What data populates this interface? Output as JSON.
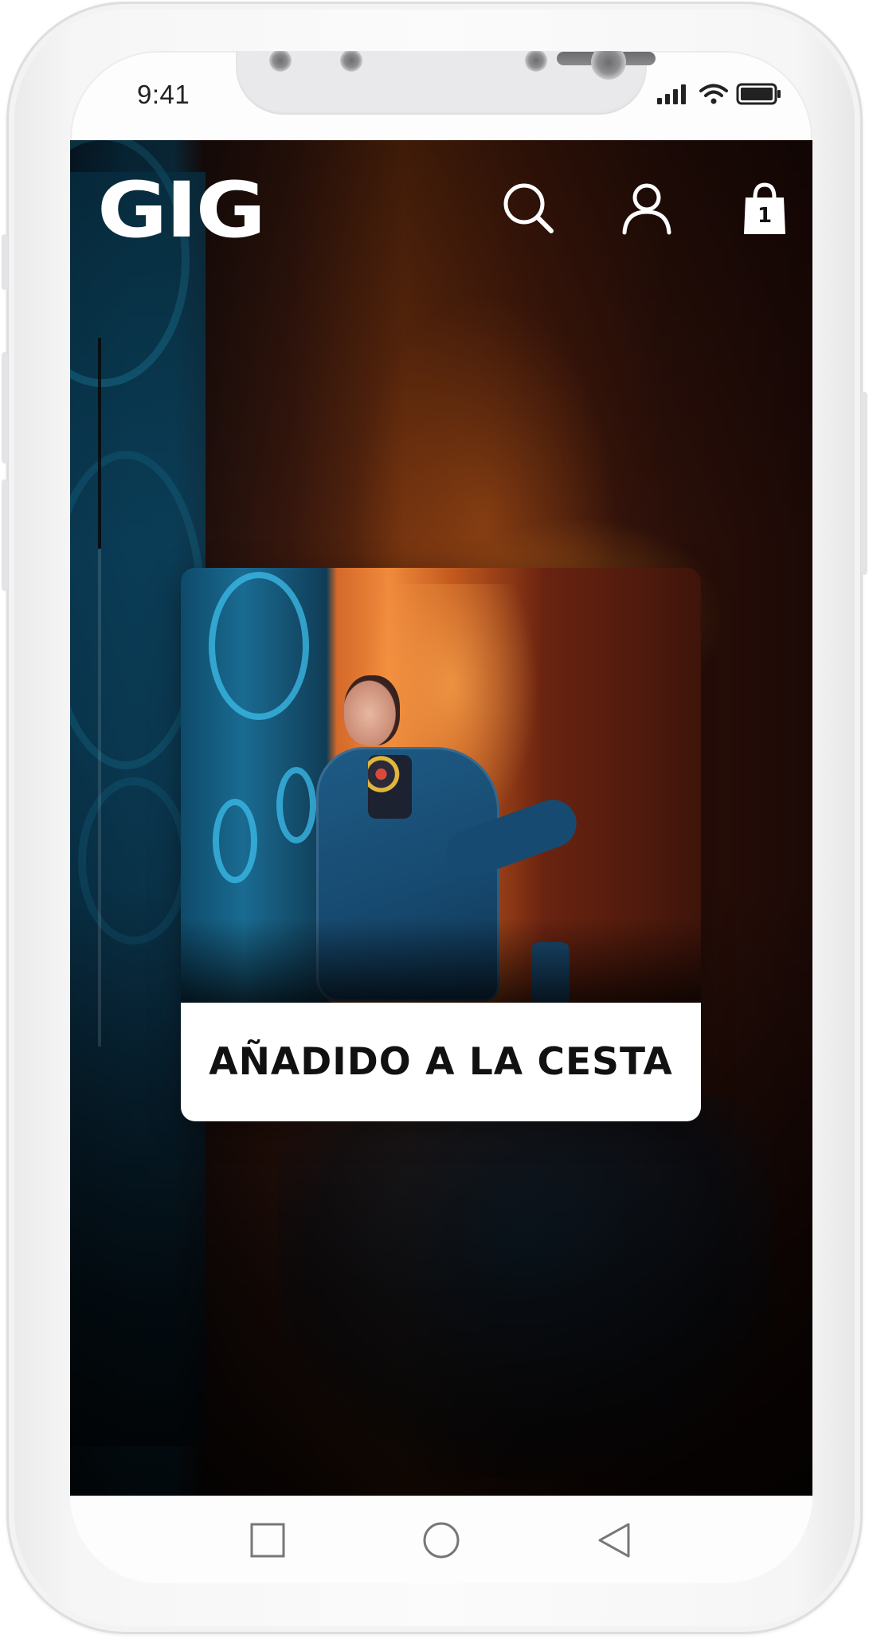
{
  "status_bar": {
    "time": "9:41"
  },
  "header": {
    "logo_text": "GIG",
    "icons": [
      "search-icon",
      "user-icon",
      "shopping-bag-icon"
    ],
    "cart_count": "1"
  },
  "modal": {
    "message": "AÑADIDO A LA CESTA"
  },
  "navigation": {
    "buttons": [
      "recents-square-icon",
      "home-circle-icon",
      "back-triangle-icon"
    ]
  },
  "colors": {
    "header_foreground": "#ffffff",
    "modal_background": "#ffffff",
    "modal_text": "#111111",
    "device_frame": "#f6f6f7"
  }
}
